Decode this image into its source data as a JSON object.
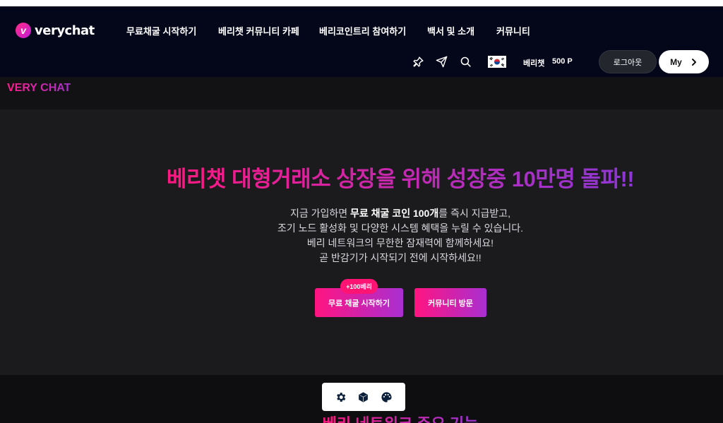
{
  "brand": {
    "name": "verychat",
    "mark": "v"
  },
  "nav": {
    "items": [
      {
        "label": "무료채굴 시작하기"
      },
      {
        "label": "베리챗 커뮤니티 카페"
      },
      {
        "label": "베리코인트리 참여하기"
      },
      {
        "label": "백서 및 소개"
      },
      {
        "label": "커뮤니티"
      }
    ]
  },
  "header_actions": {
    "icons": [
      "pin-icon",
      "send-icon",
      "search-icon"
    ],
    "language_flag": "korea-flag-icon",
    "points_label": "베리챗",
    "points_value": "500 P",
    "logout_label": "로그아웃",
    "my_label": "My",
    "my_icon": "chevron-right-icon"
  },
  "section": {
    "title": "VERY CHAT"
  },
  "hero": {
    "title": "베리챗 대형거래소 상장을 위해 성장중 10만명 돌파!!",
    "desc_line1_pre": "지금 가입하면 ",
    "desc_line1_bold": "무료 채굴 코인 100개",
    "desc_line1_post": "를 즉시 지급받고,",
    "desc_line2": "조기 노드 활성화 및 다양한 시스템 혜택을 누릴 수 있습니다.",
    "desc_line3": "베리 네트워크의 무한한 잠재력에 함께하세요!",
    "desc_line4": "곧 반감기가 시작되기 전에 시작하세요!!",
    "cta_primary": "무료 채굴 시작하기",
    "cta_badge": "+100베리",
    "cta_secondary": "커뮤니티 방문"
  },
  "bottom": {
    "title": "베리 네트워크 주요 기능"
  },
  "floating_toolbar": {
    "icons": [
      "gear-icon",
      "cube-icon",
      "palette-icon"
    ]
  },
  "colors": {
    "accent_pink": "#ff1480",
    "accent_purple": "#a92fd1",
    "header_bg": "#04061a",
    "hero_bg": "#1b1b1d"
  }
}
